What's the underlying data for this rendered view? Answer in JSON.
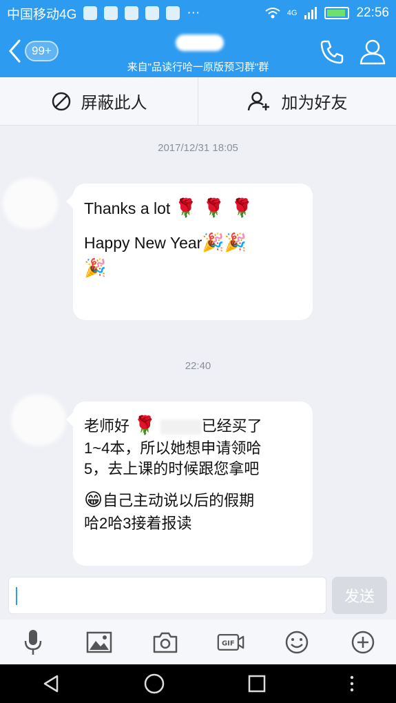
{
  "status_bar": {
    "carrier": "中国移动4G",
    "more": "···",
    "network": "4G",
    "time": "22:56"
  },
  "header": {
    "unread_badge": "99+",
    "subtitle": "来自\"品读行哈一原版预习群\"群"
  },
  "actions": {
    "block_label": "屏蔽此人",
    "add_friend_label": "加为好友"
  },
  "messages": [
    {
      "timestamp": "2017/12/31 18:05",
      "lines": [
        "Thanks a lot",
        "Happy New Year"
      ],
      "emoji_roses": "🌹 🌹 🌹",
      "emoji_party": "🎉🎉",
      "emoji_party2": "🎉"
    },
    {
      "timestamp": "22:40",
      "line1": "老师好",
      "line1_tail": "已经买了",
      "line2": "1~4本，所以她想申请领哈",
      "line3": "5，去上课的时候跟您拿吧",
      "line4": "自己主动说以后的假期",
      "line5": "哈2哈3接着报读",
      "emoji_rose": "🌹",
      "emoji_grin": "😁"
    }
  ],
  "input": {
    "value": "",
    "send_label": "发送"
  },
  "toolbar": {
    "gif_label": "GIF"
  }
}
